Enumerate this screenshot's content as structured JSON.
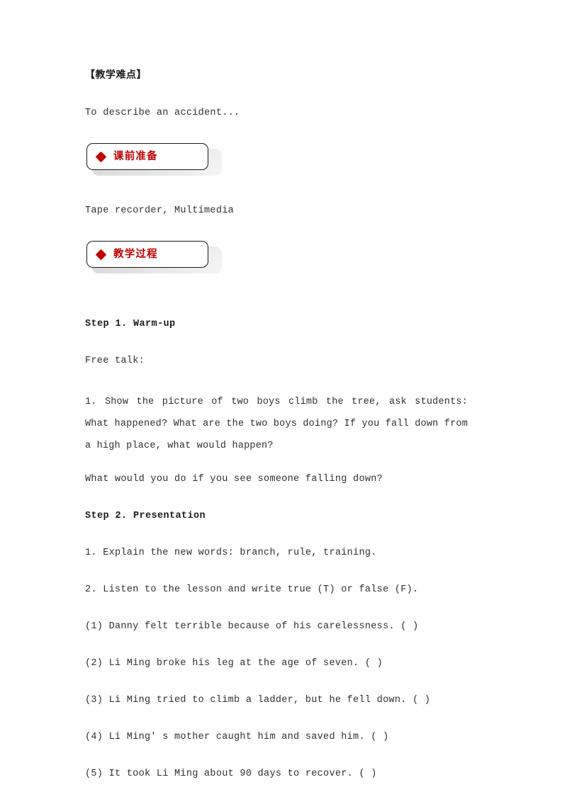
{
  "document": {
    "page_background": "#ffffff",
    "accent_red": "#c00000",
    "text_color": "#303030"
  },
  "sections": {
    "difficulty_heading": "【教学难点】",
    "difficulty_text": "To describe an accident...",
    "prep_box": {
      "icon": "diamond-icon",
      "label": "课前准备"
    },
    "prep_materials": "Tape recorder, Multimedia",
    "process_box": {
      "icon": "diamond-icon",
      "label": "教学过程"
    },
    "step1": {
      "title": "Step 1. Warm-up",
      "subtitle": "Free talk:",
      "item1": "1. Show the picture of two boys climb the tree, ask students: What happened? What are the two boys doing? If you fall down from a high place, what would happen?",
      "item2": "What would you do if you see someone falling down?"
    },
    "step2": {
      "title": "Step 2. Presentation",
      "item1": "1. Explain the new words: branch, rule, training.",
      "item2": "2. Listen to the lesson and write true (T) or false (F).",
      "statements": [
        "(1) Danny felt terrible because of his carelessness. (    )",
        "(2) Li Ming broke his leg at the age of seven. (    )",
        "(3) Li Ming tried to climb a ladder, but he fell down. (    )",
        "(4) Li Ming' s mother caught him and saved him. (    )",
        "(5) It took Li Ming about 90 days to recover. (    )"
      ]
    }
  }
}
